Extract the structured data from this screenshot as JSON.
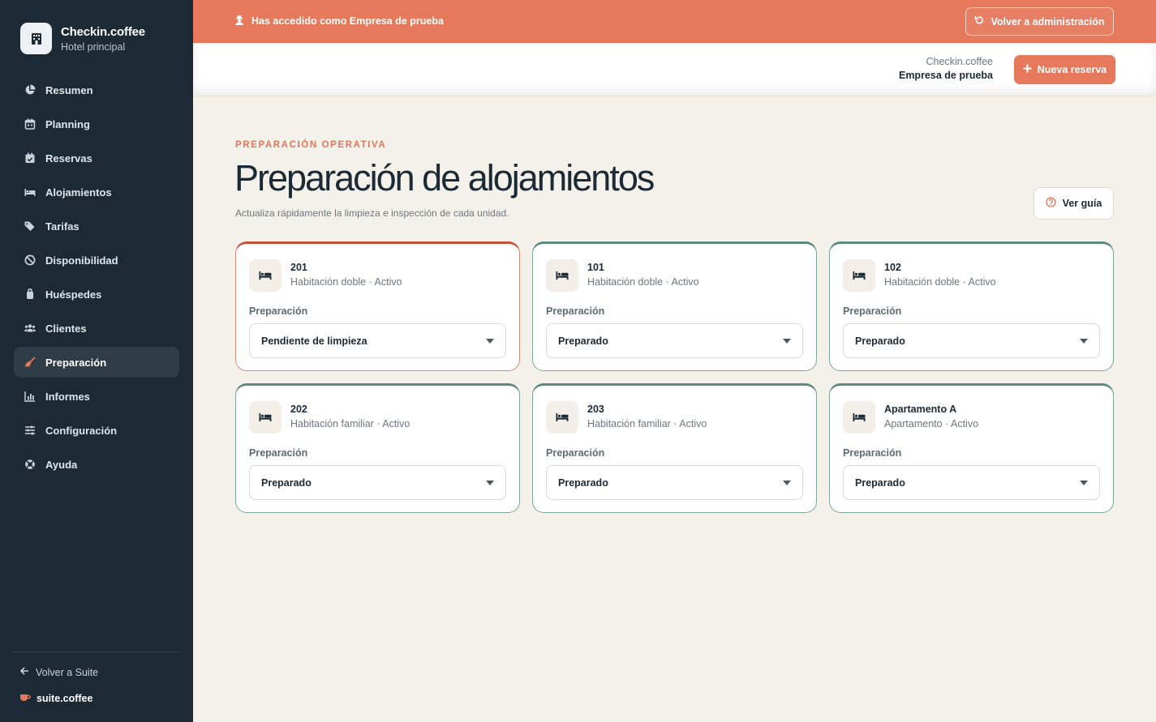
{
  "brand": {
    "name": "Checkin.coffee",
    "subtitle": "Hotel principal"
  },
  "nav": [
    {
      "label": "Resumen",
      "icon": "pie-chart-icon",
      "active": false
    },
    {
      "label": "Planning",
      "icon": "calendar-icon",
      "active": false
    },
    {
      "label": "Reservas",
      "icon": "calendar-check-icon",
      "active": false
    },
    {
      "label": "Alojamientos",
      "icon": "bed-icon",
      "active": false
    },
    {
      "label": "Tarifas",
      "icon": "tags-icon",
      "active": false
    },
    {
      "label": "Disponibilidad",
      "icon": "ban-icon",
      "active": false
    },
    {
      "label": "Huéspedes",
      "icon": "suitcase-icon",
      "active": false
    },
    {
      "label": "Clientes",
      "icon": "users-icon",
      "active": false
    },
    {
      "label": "Preparación",
      "icon": "broom-icon",
      "active": true
    },
    {
      "label": "Informes",
      "icon": "bar-chart-icon",
      "active": false
    },
    {
      "label": "Configuración",
      "icon": "sliders-icon",
      "active": false
    },
    {
      "label": "Ayuda",
      "icon": "life-ring-icon",
      "active": false
    }
  ],
  "sidebar_footer": {
    "back_label": "Volver a Suite",
    "suite_label": "suite.coffee"
  },
  "banner": {
    "text": "Has accedido como Empresa de prueba",
    "button_label": "Volver a administración"
  },
  "header": {
    "app": "Checkin.coffee",
    "company": "Empresa de prueba",
    "new_button_label": "Nueva reserva"
  },
  "page": {
    "eyebrow": "PREPARACIÓN OPERATIVA",
    "title": "Preparación de alojamientos",
    "subtitle": "Actualiza rápidamente la limpieza e inspección de cada unidad.",
    "guide_button_label": "Ver guía"
  },
  "field_label": "Preparación",
  "units": [
    {
      "name": "201",
      "meta": "Habitación doble · Activo",
      "status": "Pendiente de limpieza",
      "state": "dirty"
    },
    {
      "name": "101",
      "meta": "Habitación doble · Activo",
      "status": "Preparado",
      "state": "ready"
    },
    {
      "name": "102",
      "meta": "Habitación doble · Activo",
      "status": "Preparado",
      "state": "ready"
    },
    {
      "name": "202",
      "meta": "Habitación familiar · Activo",
      "status": "Preparado",
      "state": "ready"
    },
    {
      "name": "203",
      "meta": "Habitación familiar · Activo",
      "status": "Preparado",
      "state": "ready"
    },
    {
      "name": "Apartamento A",
      "meta": "Apartamento · Activo",
      "status": "Preparado",
      "state": "ready"
    }
  ],
  "colors": {
    "sidebar": "#1b2a35",
    "accent": "#e6785c",
    "ready_border": "#5b8a7f",
    "pending_border": "#c4533d",
    "background": "#f4f1eb"
  }
}
